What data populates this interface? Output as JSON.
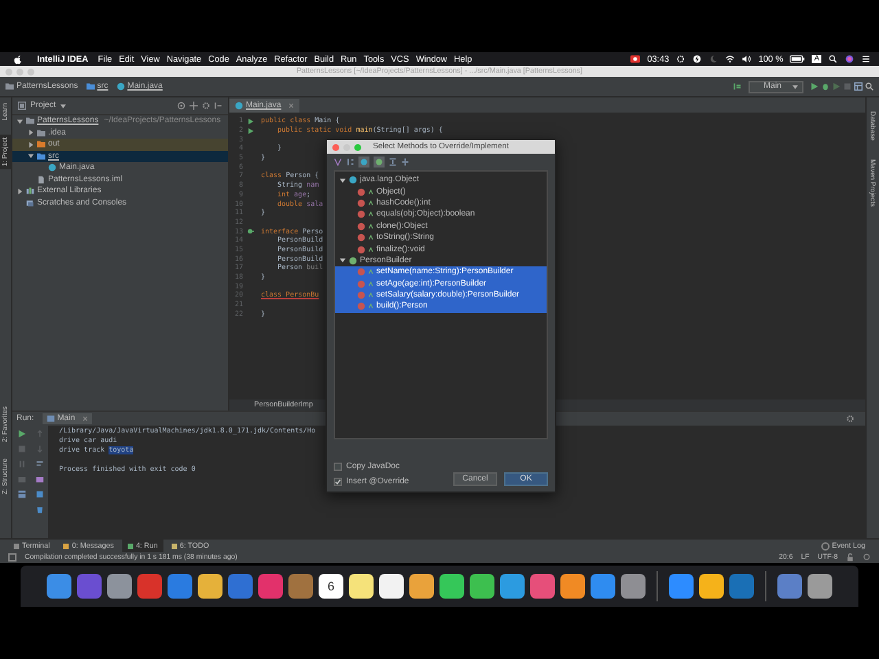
{
  "menubar": {
    "app": "IntelliJ IDEA",
    "menus": [
      "File",
      "Edit",
      "View",
      "Navigate",
      "Code",
      "Analyze",
      "Refactor",
      "Build",
      "Run",
      "Tools",
      "VCS",
      "Window",
      "Help"
    ],
    "clock": "03:43",
    "battery": "100 %",
    "input_source": "A"
  },
  "window": {
    "title": "PatternsLessons [~/IdeaProjects/PatternsLessons] - .../src/Main.java [PatternsLessons]"
  },
  "navbar": {
    "breadcrumbs": [
      "PatternsLessons",
      "src",
      "Main.java"
    ],
    "run_config": "Main"
  },
  "left_strip": {
    "top": [
      {
        "label": "Learn",
        "selected": false
      },
      {
        "label": "1: Project",
        "selected": true
      }
    ],
    "bottom": [
      {
        "label": "2: Favorites",
        "selected": false
      },
      {
        "label": "Z: Structure",
        "selected": false
      }
    ]
  },
  "right_strip": [
    "Database",
    "Maven Projects"
  ],
  "project": {
    "title": "Project",
    "tree": [
      {
        "label": "PatternsLessons",
        "hint": "~/IdeaProjects/PatternsLessons",
        "kind": "module",
        "expanded": true,
        "selected": false,
        "children": [
          {
            "label": ".idea",
            "kind": "folder",
            "expanded": false,
            "selected": false
          },
          {
            "label": "out",
            "kind": "excluded",
            "expanded": false,
            "selected": false
          },
          {
            "label": "src",
            "kind": "source",
            "expanded": true,
            "selected": true,
            "children": [
              {
                "label": "Main.java",
                "kind": "class",
                "selected": false
              }
            ]
          },
          {
            "label": "PatternsLessons.iml",
            "kind": "file",
            "selected": false
          }
        ]
      },
      {
        "label": "External Libraries",
        "kind": "library",
        "expanded": false,
        "selected": false
      },
      {
        "label": "Scratches and Consoles",
        "kind": "scratch",
        "selected": false
      }
    ]
  },
  "editor": {
    "tab": "Main.java",
    "breadcrumb": "PersonBuilderImp",
    "lines": [
      {
        "number": "1",
        "kind": "run",
        "tokens": [
          {
            "kind": "keyword",
            "text": "public class "
          },
          {
            "kind": "plain",
            "text": "Main {"
          }
        ]
      },
      {
        "number": "2",
        "kind": "run",
        "indent": true,
        "tokens": [
          {
            "kind": "keyword",
            "text": "public static void "
          },
          {
            "kind": "method",
            "text": "main"
          },
          {
            "kind": "plain",
            "text": "(String[] args) {"
          }
        ]
      },
      {
        "number": "3"
      },
      {
        "number": "4",
        "indent": true,
        "tokens": [
          {
            "kind": "plain",
            "text": "}"
          }
        ]
      },
      {
        "number": "5",
        "tokens": [
          {
            "kind": "plain",
            "text": "}"
          }
        ]
      },
      {
        "number": "6"
      },
      {
        "number": "7",
        "tokens": [
          {
            "kind": "keyword",
            "text": "class "
          },
          {
            "kind": "plain",
            "text": "Person {"
          }
        ]
      },
      {
        "number": "8",
        "indent": true,
        "tokens": [
          {
            "kind": "plain",
            "text": "String "
          },
          {
            "kind": "field",
            "text": "nam"
          }
        ]
      },
      {
        "number": "9",
        "indent": true,
        "tokens": [
          {
            "kind": "keyword",
            "text": "int "
          },
          {
            "kind": "field",
            "text": "age"
          },
          {
            "kind": "plain",
            "text": ";"
          }
        ]
      },
      {
        "number": "10",
        "indent": true,
        "tokens": [
          {
            "kind": "keyword",
            "text": "double "
          },
          {
            "kind": "field",
            "text": "sala"
          }
        ]
      },
      {
        "number": "11",
        "tokens": [
          {
            "kind": "plain",
            "text": "}"
          }
        ]
      },
      {
        "number": "12"
      },
      {
        "number": "13",
        "kind": "implemented",
        "tokens": [
          {
            "kind": "keyword",
            "text": "interface "
          },
          {
            "kind": "plain",
            "text": "Perso"
          }
        ]
      },
      {
        "number": "14",
        "indent": true,
        "tokens": [
          {
            "kind": "plain",
            "text": "PersonBuild"
          }
        ]
      },
      {
        "number": "15",
        "indent": true,
        "tokens": [
          {
            "kind": "plain",
            "text": "PersonBuild"
          }
        ]
      },
      {
        "number": "16",
        "indent": true,
        "tokens": [
          {
            "kind": "plain",
            "text": "PersonBuild"
          }
        ]
      },
      {
        "number": "17",
        "indent": true,
        "tokens": [
          {
            "kind": "plain",
            "text": "Person "
          },
          {
            "kind": "unused",
            "text": "buil"
          }
        ]
      },
      {
        "number": "18",
        "tokens": [
          {
            "kind": "plain",
            "text": "}"
          }
        ]
      },
      {
        "number": "19"
      },
      {
        "number": "20",
        "tokens": [
          {
            "kind": "error",
            "text": "class PersonBu"
          }
        ]
      },
      {
        "number": "21"
      },
      {
        "number": "22",
        "tokens": [
          {
            "kind": "plain",
            "text": "}"
          }
        ]
      }
    ]
  },
  "run_panel": {
    "label": "Run:",
    "tab": "Main",
    "output": [
      {
        "kind": "text",
        "text": "/Library/Java/JavaVirtualMachines/jdk1.8.0_171.jdk/Contents/Ho"
      },
      {
        "kind": "text",
        "text": "drive car audi"
      },
      {
        "kind": "text",
        "text": "drive track ",
        "highlight": "toyota"
      },
      {
        "kind": "blank"
      },
      {
        "kind": "text",
        "text": "Process finished with exit code 0"
      }
    ]
  },
  "dialog": {
    "title": "Select Methods to Override/Implement",
    "groups": [
      {
        "name": "java.lang.Object",
        "kind": "class",
        "expanded": true,
        "methods": [
          {
            "label": "Object()",
            "selected": false
          },
          {
            "label": "hashCode():int",
            "selected": false
          },
          {
            "label": "equals(obj:Object):boolean",
            "selected": false
          },
          {
            "label": "clone():Object",
            "selected": false
          },
          {
            "label": "toString():String",
            "selected": false
          },
          {
            "label": "finalize():void",
            "selected": false
          }
        ]
      },
      {
        "name": "PersonBuilder",
        "kind": "interface",
        "expanded": true,
        "methods": [
          {
            "label": "setName(name:String):PersonBuilder",
            "selected": true
          },
          {
            "label": "setAge(age:int):PersonBuilder",
            "selected": true
          },
          {
            "label": "setSalary(salary:double):PersonBuilder",
            "selected": true
          },
          {
            "label": "build():Person",
            "selected": true
          }
        ]
      }
    ],
    "options": [
      {
        "label": "Copy JavaDoc",
        "checked": false
      },
      {
        "label": "Insert @Override",
        "checked": true
      }
    ],
    "buttons": [
      {
        "label": "Cancel",
        "default": false
      },
      {
        "label": "OK",
        "default": true
      }
    ]
  },
  "tool_tabs": [
    {
      "label": "Terminal",
      "selected": false
    },
    {
      "label": "0: Messages",
      "selected": false
    },
    {
      "label": "4: Run",
      "selected": true
    },
    {
      "label": "6: TODO",
      "selected": false
    }
  ],
  "event_log": "Event Log",
  "status_bar": {
    "message": "Compilation completed successfully in 1 s 181 ms (38 minutes ago)",
    "position": "20:6",
    "line_separator": "LF",
    "encoding": "UTF-8"
  },
  "dock": [
    {
      "kind": "app",
      "color": "#3b8de6"
    },
    {
      "kind": "app",
      "color": "#6a4ed0"
    },
    {
      "kind": "app",
      "color": "#8c929c"
    },
    {
      "kind": "app",
      "color": "#d8322a"
    },
    {
      "kind": "app",
      "color": "#2a7be0"
    },
    {
      "kind": "app",
      "color": "#e5b13a"
    },
    {
      "kind": "app",
      "color": "#2f6fd2"
    },
    {
      "kind": "app",
      "color": "#e2316b"
    },
    {
      "kind": "app",
      "color": "#a0713f"
    },
    {
      "kind": "app",
      "color": "#ffffff",
      "label": "6"
    },
    {
      "kind": "app",
      "color": "#f5e27a"
    },
    {
      "kind": "app",
      "color": "#f2f2f2"
    },
    {
      "kind": "app",
      "color": "#e9a23b"
    },
    {
      "kind": "app",
      "color": "#35c759"
    },
    {
      "kind": "app",
      "color": "#3dbf4f"
    },
    {
      "kind": "app",
      "color": "#2c9be0"
    },
    {
      "kind": "app",
      "color": "#e64f7a"
    },
    {
      "kind": "app",
      "color": "#f08a24"
    },
    {
      "kind": "app",
      "color": "#2f8cf0"
    },
    {
      "kind": "app",
      "color": "#8e8e93"
    },
    {
      "kind": "separator"
    },
    {
      "kind": "app",
      "color": "#2d8cff"
    },
    {
      "kind": "app",
      "color": "#f5b21a"
    },
    {
      "kind": "app",
      "color": "#1a6fb5"
    },
    {
      "kind": "separator"
    },
    {
      "kind": "app",
      "color": "#5b7fc6"
    },
    {
      "kind": "app",
      "color": "#9a9a9a"
    }
  ]
}
